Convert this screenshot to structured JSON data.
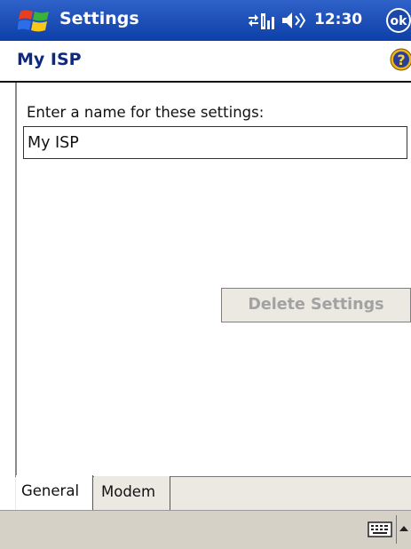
{
  "title_bar": {
    "app_title": "Settings",
    "clock": "12:30",
    "ok_label": "ok"
  },
  "header": {
    "page_title": "My ISP",
    "help_icon": "help-icon"
  },
  "form": {
    "prompt_label": "Enter a name for these settings:",
    "name_value": "My ISP"
  },
  "actions": {
    "delete_label": "Delete Settings"
  },
  "tabs": [
    {
      "label": "General",
      "selected": true
    },
    {
      "label": "Modem",
      "selected": false
    }
  ],
  "menu_bar": {
    "input_icon": "keyboard-icon"
  },
  "colors": {
    "titlebar": "#1c4fb8",
    "title_text": "#0d2a80",
    "disabled_text": "#a2a2a2",
    "button_face": "#ece9e2"
  }
}
